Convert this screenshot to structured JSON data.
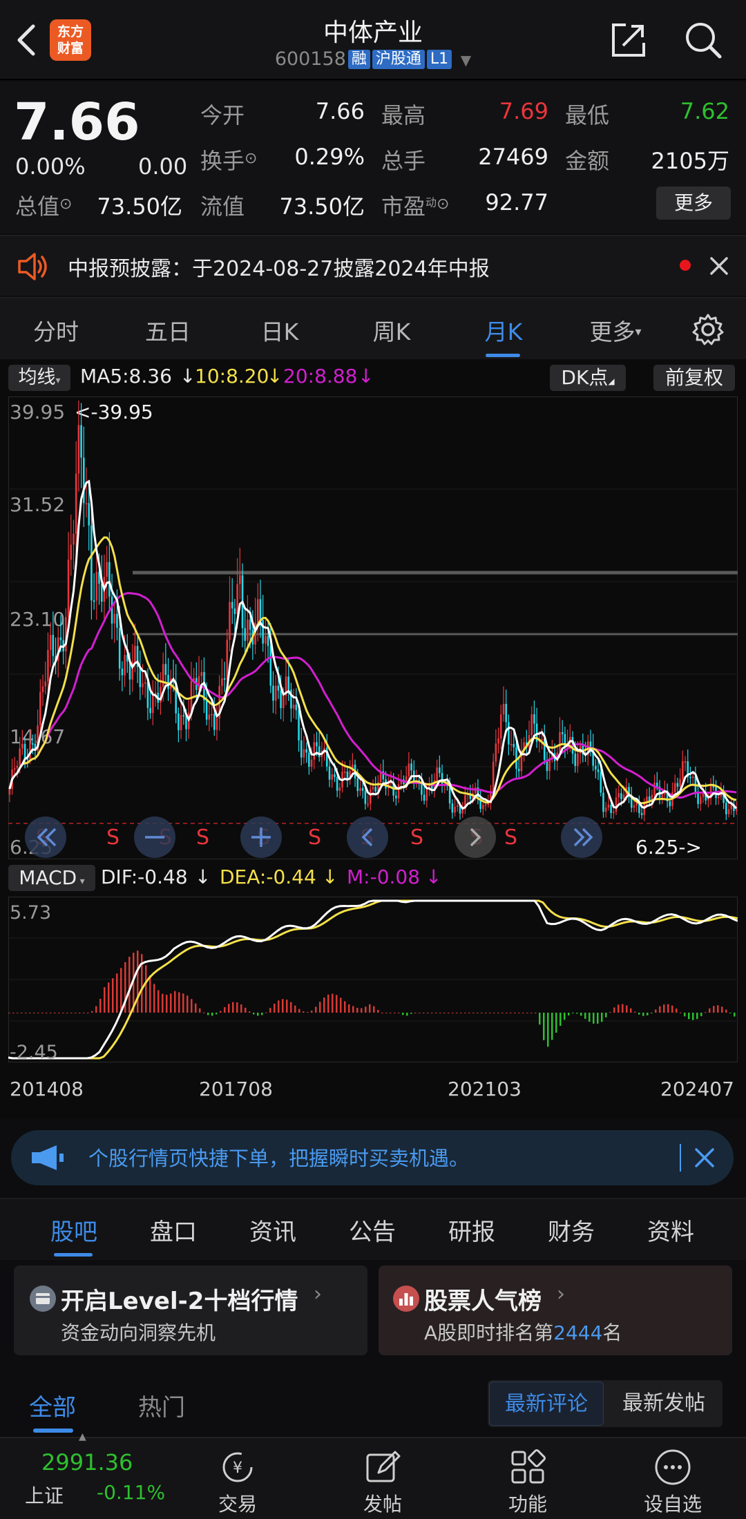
{
  "header": {
    "title": "中体产业",
    "code": "600158",
    "tags": [
      "融",
      "沪股通",
      "L1"
    ]
  },
  "quote": {
    "price": "7.66",
    "change_pct": "0.00%",
    "change": "0.00",
    "fields": [
      {
        "label": "今开",
        "value": "7.66",
        "color": "#f0f0f0"
      },
      {
        "label": "最高",
        "value": "7.69",
        "color": "#e8363c"
      },
      {
        "label": "最低",
        "value": "7.62",
        "color": "#2ec02e"
      },
      {
        "label": "换手",
        "value": "0.29%",
        "color": "#f0f0f0"
      },
      {
        "label": "总手",
        "value": "27469",
        "color": "#f0f0f0"
      },
      {
        "label": "金额",
        "value": "2105万",
        "color": "#f0f0f0"
      },
      {
        "label": "总值",
        "value": "73.50亿",
        "color": "#f0f0f0"
      },
      {
        "label": "流值",
        "value": "73.50亿",
        "color": "#f0f0f0"
      },
      {
        "label": "市盈",
        "value": "92.77",
        "color": "#f0f0f0"
      }
    ],
    "pe_superscript": "动",
    "more_label": "更多"
  },
  "notice": {
    "text": "中报预披露：于2024-08-27披露2024年中报"
  },
  "tabs": [
    "分时",
    "五日",
    "日K",
    "周K",
    "月K",
    "更多"
  ],
  "active_tab": "月K",
  "chart": {
    "ma_selector": "均线",
    "ma5": "MA5:8.36",
    "ma10": "10:8.20",
    "ma20": "20:8.88",
    "dk_label": "DK点",
    "adjust_label": "前复权",
    "price_ticks": [
      "39.95",
      "31.52",
      "23.10",
      "14.67",
      "6.25"
    ],
    "max_annotation": "<-39.95",
    "min_annotation": "6.25->",
    "sell_marker": "S",
    "macd_selector": "MACD",
    "dif": "DIF:-0.48",
    "dea": "DEA:-0.44",
    "m": "M:-0.08",
    "macd_ticks": [
      "5.73",
      "-2.45"
    ],
    "x_labels": [
      "201408",
      "201708",
      "202103",
      "202407"
    ],
    "colors": {
      "up": "#e8363c",
      "down": "#27d8e8",
      "ma5": "#ffffff",
      "ma10": "#f4e04a",
      "ma20": "#d21fcf",
      "macd_up": "#d83a35",
      "macd_down": "#2ec02e"
    }
  },
  "chart_data": {
    "type": "line",
    "title": "",
    "x": [
      "201408",
      "201708",
      "202103",
      "202407"
    ],
    "ylim": [
      6.25,
      39.95
    ],
    "series": [
      {
        "name": "MA5",
        "values": [
          8.36
        ]
      },
      {
        "name": "10",
        "values": [
          8.2
        ]
      },
      {
        "name": "20",
        "values": [
          8.88
        ]
      }
    ]
  },
  "ad": {
    "text": "个股行情页快捷下单，把握瞬时买卖机遇。"
  },
  "section_tabs": [
    "股吧",
    "盘口",
    "资讯",
    "公告",
    "研报",
    "财务",
    "资料"
  ],
  "cards": {
    "left_title": "开启Level-2十档行情",
    "left_sub": "资金动向洞察先机",
    "right_title": "股票人气榜",
    "right_sub_prefix": "A股即时排名第",
    "right_rank": "2444",
    "right_sub_suffix": "名"
  },
  "filters": {
    "all": "全部",
    "hot": "热门",
    "latest_comment": "最新评论",
    "latest_post": "最新发帖"
  },
  "bottom_nav": {
    "index_value": "2991.36",
    "index_name": "上证",
    "index_change": "-0.11%",
    "items": [
      "交易",
      "发帖",
      "功能",
      "设自选"
    ]
  }
}
